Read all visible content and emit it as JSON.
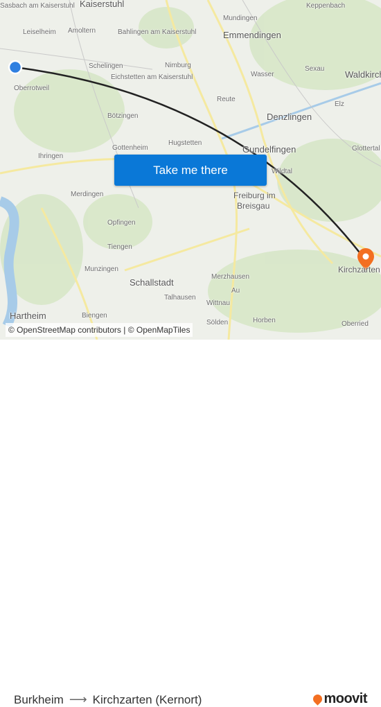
{
  "map": {
    "labels": [
      {
        "text": "Kaiserstuhl",
        "cls": "big"
      },
      {
        "text": "Sasbach am Kaiserstuhl",
        "cls": ""
      },
      {
        "text": "Leiselheim",
        "cls": ""
      },
      {
        "text": "Amoltern",
        "cls": ""
      },
      {
        "text": "Bahlingen am Kaiserstuhl",
        "cls": ""
      },
      {
        "text": "Mundingen",
        "cls": ""
      },
      {
        "text": "Keppenbach",
        "cls": ""
      },
      {
        "text": "Emmendingen",
        "cls": "big"
      },
      {
        "text": "Schelingen",
        "cls": ""
      },
      {
        "text": "Nimburg",
        "cls": ""
      },
      {
        "text": "Eichstetten am Kaiserstuhl",
        "cls": ""
      },
      {
        "text": "Wasser",
        "cls": ""
      },
      {
        "text": "Sexau",
        "cls": ""
      },
      {
        "text": "Waldkirch",
        "cls": "big"
      },
      {
        "text": "Oberrotweil",
        "cls": ""
      },
      {
        "text": "Reute",
        "cls": ""
      },
      {
        "text": "Elz",
        "cls": ""
      },
      {
        "text": "Denzlingen",
        "cls": "big"
      },
      {
        "text": "Bötzingen",
        "cls": ""
      },
      {
        "text": "Gottenheim",
        "cls": ""
      },
      {
        "text": "Hugstetten",
        "cls": ""
      },
      {
        "text": "Gundelfingen",
        "cls": "big"
      },
      {
        "text": "Glottertal",
        "cls": ""
      },
      {
        "text": "Ihringen",
        "cls": ""
      },
      {
        "text": "Wildtal",
        "cls": ""
      },
      {
        "text": "Merdingen",
        "cls": ""
      },
      {
        "text": "Freiburg im",
        "cls": "mid"
      },
      {
        "text": "Breisgau",
        "cls": "mid"
      },
      {
        "text": "Opfingen",
        "cls": ""
      },
      {
        "text": "Tiengen",
        "cls": ""
      },
      {
        "text": "Munzingen",
        "cls": ""
      },
      {
        "text": "Schallstadt",
        "cls": "big"
      },
      {
        "text": "Merzhausen",
        "cls": ""
      },
      {
        "text": "Au",
        "cls": ""
      },
      {
        "text": "Talhausen",
        "cls": ""
      },
      {
        "text": "Wittnau",
        "cls": ""
      },
      {
        "text": "Hartheim",
        "cls": "big"
      },
      {
        "text": "Biengen",
        "cls": ""
      },
      {
        "text": "Sölden",
        "cls": ""
      },
      {
        "text": "Horben",
        "cls": ""
      },
      {
        "text": "Oberried",
        "cls": ""
      },
      {
        "text": "Kirchzarten",
        "cls": "mid"
      }
    ],
    "route_color": "#222222",
    "origin_color": "#2f7fe0",
    "destination_color": "#f36f21"
  },
  "cta": {
    "label": "Take me there"
  },
  "attribution": "© OpenStreetMap contributors | © OpenMapTiles",
  "footer": {
    "origin": "Burkheim",
    "arrow": "⟶",
    "destination": "Kirchzarten (Kernort)",
    "logo": "moovit"
  }
}
